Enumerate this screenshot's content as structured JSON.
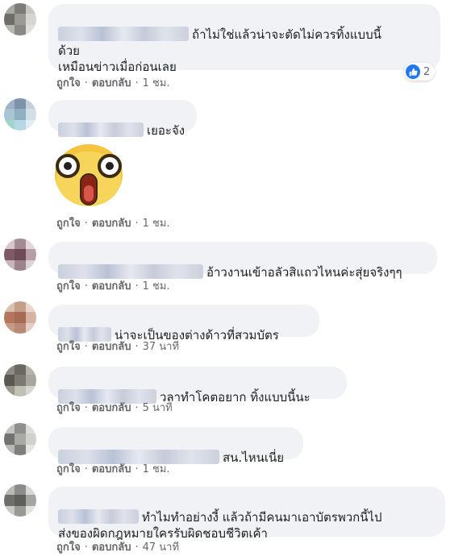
{
  "comments": [
    {
      "text": "ถ้าไม่ใช่แล้วน่าจะตัดไม่ควรทิ้งแบบนี้\nด้วย\nเหมือนข่าวเมื่อก่อนเลย",
      "like": "ถูกใจ",
      "reply": "ตอบกลับ",
      "time": "1 ชม.",
      "reaction_count": "2"
    },
    {
      "text": "เยอะจัง",
      "like": "ถูกใจ",
      "reply": "ตอบกลับ",
      "time": "1 ชม.",
      "sticker": "shocked-face-sticker"
    },
    {
      "text": "อ้าวงานเข้าอลัวสิแถวไหนค่ะสุ่ยจริงๆๆ",
      "like": "ถูกใจ",
      "reply": "ตอบกลับ",
      "time": "1 ชม."
    },
    {
      "text": "น่าจะเป็นของต่างด้าวที่สวมบัตร",
      "like": "ถูกใจ",
      "reply": "ตอบกลับ",
      "time": "37 นาที"
    },
    {
      "text": "วลาทำโคตอยาก ทิ้งแบบนี้นะ",
      "like": "ถูกใจ",
      "reply": "ตอบกลับ",
      "time": "5 นาที"
    },
    {
      "text": "สน.ไหนเนี่ย",
      "like": "ถูกใจ",
      "reply": "ตอบกลับ",
      "time": "1 ชม."
    },
    {
      "text": "ทำไมทำอย่างงี้ แล้วถ้ามีคนมาเอาบัตรพวกนี้ไป\nส่งของผิดกฎหมายใครรับผิดชอบชีวิตเค้า",
      "like": "ถูกใจ",
      "reply": "ตอบกลับ",
      "time": "47 นาที"
    }
  ],
  "separator": "·",
  "colors": {
    "bubble": "#f0f2f5",
    "meta": "#65676b",
    "like_blue": "#2078f4"
  }
}
